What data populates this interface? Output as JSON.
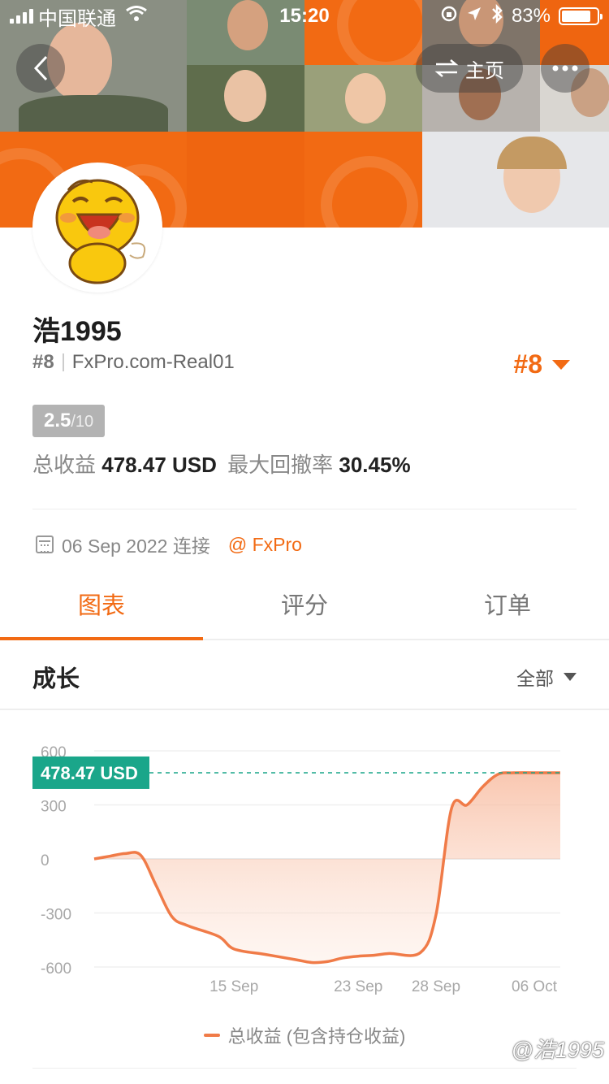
{
  "status_bar": {
    "carrier": "中国联通",
    "time": "15:20",
    "battery": "83%",
    "battery_level": 0.83
  },
  "header": {
    "home_label": "主页",
    "back_icon": "chevron-left-icon",
    "more_icon": "ellipsis-icon",
    "switch_icon": "swap-icon"
  },
  "profile": {
    "username": "浩1995",
    "rank_small": "#8",
    "server": "FxPro.com-Real01",
    "rank_big": "#8",
    "score": "2.5",
    "score_max": "/10",
    "total_profit_label": "总收益",
    "total_profit_value": "478.47 USD",
    "max_drawdown_label": "最大回撤率",
    "max_drawdown_value": "30.45%",
    "connected_date": "06 Sep 2022 连接",
    "broker": "@ FxPro"
  },
  "tabs": [
    {
      "label": "图表",
      "active": true
    },
    {
      "label": "评分",
      "active": false
    },
    {
      "label": "订单",
      "active": false
    }
  ],
  "section": {
    "title": "成长",
    "filter": "全部"
  },
  "chart_data": {
    "type": "area",
    "ylim": [
      -600,
      600
    ],
    "yticks": [
      "600",
      "300",
      "0",
      "-300",
      "-600"
    ],
    "xticks": [
      "15 Sep",
      "23 Sep",
      "28 Sep",
      "06 Oct"
    ],
    "current_label": "478.47 USD",
    "current_value": 478.47,
    "series": [
      {
        "name": "总收益 (包含持仓收益)",
        "points": [
          [
            "06 Sep",
            0
          ],
          [
            "07 Sep",
            15
          ],
          [
            "08 Sep",
            30
          ],
          [
            "09 Sep",
            20
          ],
          [
            "10 Sep",
            -150
          ],
          [
            "11 Sep",
            -320
          ],
          [
            "12 Sep",
            -370
          ],
          [
            "14 Sep",
            -430
          ],
          [
            "15 Sep",
            -500
          ],
          [
            "17 Sep",
            -530
          ],
          [
            "19 Sep",
            -560
          ],
          [
            "20 Sep",
            -575
          ],
          [
            "21 Sep",
            -570
          ],
          [
            "22 Sep",
            -550
          ],
          [
            "23 Sep",
            -540
          ],
          [
            "24 Sep",
            -535
          ],
          [
            "25 Sep",
            -525
          ],
          [
            "27 Sep",
            -520
          ],
          [
            "28 Sep",
            -310
          ],
          [
            "29 Sep",
            280
          ],
          [
            "30 Sep",
            300
          ],
          [
            "01 Oct",
            400
          ],
          [
            "02 Oct",
            470
          ],
          [
            "03 Oct",
            478
          ],
          [
            "05 Oct",
            478
          ],
          [
            "06 Oct",
            478.47
          ]
        ]
      }
    ],
    "colors": {
      "line": "#f07b48",
      "label_bg": "#1aa68a",
      "ref_line": "#1aa68a"
    },
    "grid": true,
    "legend": "bottom"
  },
  "watermark": "@浩1995"
}
